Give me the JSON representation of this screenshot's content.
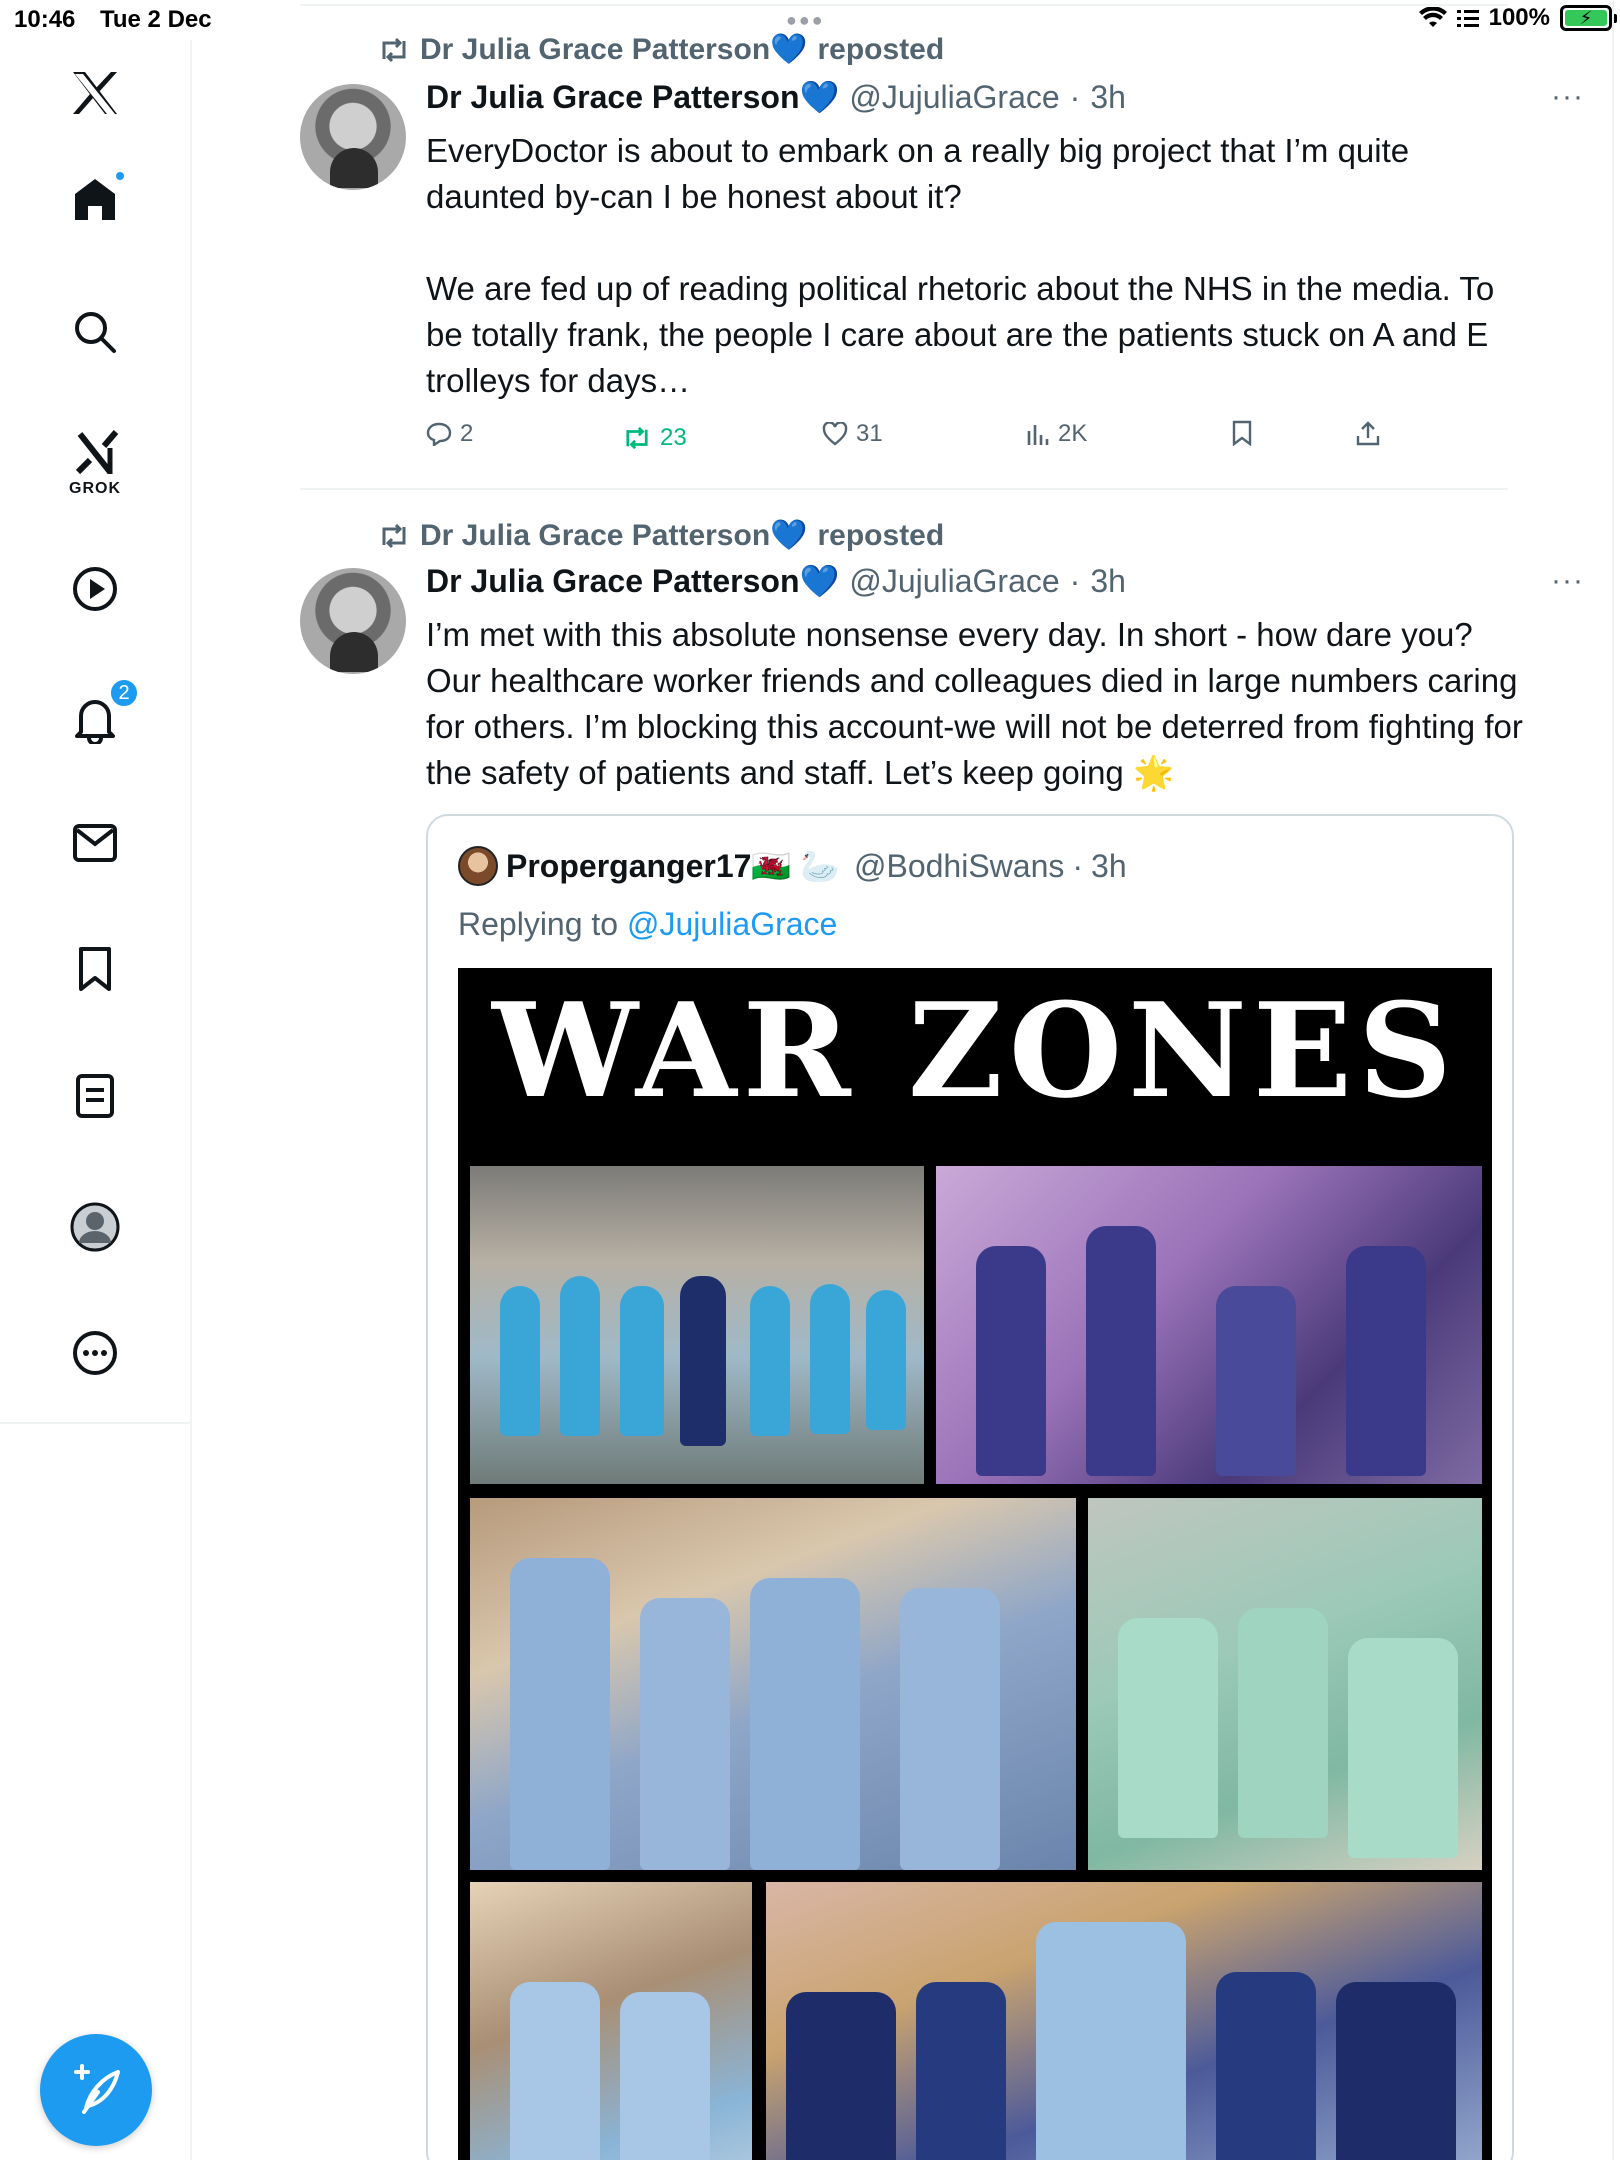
{
  "status_bar": {
    "time": "10:46",
    "date": "Tue 2 Dec",
    "battery": "100%"
  },
  "sidebar": {
    "items": [
      {
        "name": "x-logo",
        "interactable": true
      },
      {
        "name": "home",
        "interactable": true
      },
      {
        "name": "search",
        "interactable": true
      },
      {
        "name": "grok",
        "label": "GROK",
        "interactable": true
      },
      {
        "name": "video",
        "interactable": true
      },
      {
        "name": "notifications",
        "badge": "2",
        "interactable": true
      },
      {
        "name": "messages",
        "interactable": true
      },
      {
        "name": "bookmarks",
        "interactable": true
      },
      {
        "name": "lists",
        "interactable": true
      },
      {
        "name": "profile",
        "interactable": true
      },
      {
        "name": "more",
        "interactable": true
      }
    ],
    "accent": "#1d9bf0"
  },
  "posts": [
    {
      "repost_by": "Dr Julia Grace Patterson💙",
      "repost_label": "reposted",
      "name": "Dr Julia Grace Patterson💙",
      "handle": "@JujuliaGrace",
      "time": "3h",
      "text": "EveryDoctor is about to embark on a really big project that I’m quite daunted by-can I be honest about it?\n\nWe are fed up of reading political rhetoric about the NHS in the media. To be totally frank, the people I care about are the patients stuck on A and E trolleys for days…",
      "metrics": {
        "replies": "2",
        "reposts": "23",
        "likes": "31",
        "views": "2K"
      }
    },
    {
      "repost_by": "Dr Julia Grace Patterson💙",
      "repost_label": "reposted",
      "name": "Dr Julia Grace Patterson💙",
      "handle": "@JujuliaGrace",
      "time": "3h",
      "text": "I’m met with this absolute nonsense every day. In short - how dare you? Our healthcare worker friends and colleagues died in large numbers caring for others. I’m blocking this account-we will not be deterred from fighting for the safety of patients and staff. Let’s keep going 🌟",
      "quote": {
        "name": "Properganger17🏴󠁧󠁢󠁷󠁬󠁳󠁿 🦢",
        "handle": "@BodhiSwans",
        "time": "3h",
        "replying_prefix": "Replying to ",
        "replying_to": "@JujuliaGrace",
        "image_title": "WAR ZONES"
      }
    }
  ]
}
